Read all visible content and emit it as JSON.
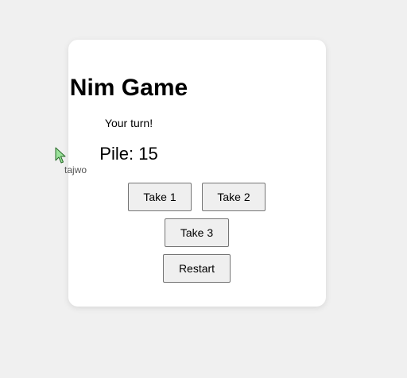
{
  "game": {
    "title": "Nim Game",
    "status": "Your turn!",
    "pile_label": "Pile:",
    "pile_count": "15",
    "pile_text": "Pile: 15"
  },
  "buttons": {
    "take1": "Take 1",
    "take2": "Take 2",
    "take3": "Take 3",
    "restart": "Restart"
  },
  "cursor": {
    "label": "tajwo",
    "icon": "mouse-pointer-icon"
  },
  "colors": {
    "background": "#f0f0f0",
    "card": "#ffffff",
    "button": "#efefef",
    "cursor_fill": "#9be29b"
  }
}
